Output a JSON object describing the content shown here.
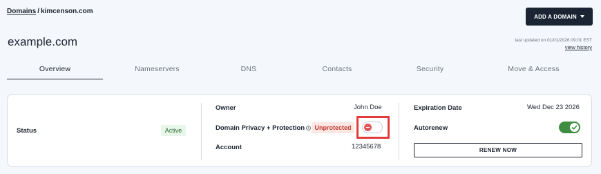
{
  "breadcrumb": {
    "root": "Domains",
    "separator": "/",
    "current": "kimcenson.com"
  },
  "header": {
    "add_domain_label": "ADD A DOMAIN",
    "title": "example.com"
  },
  "last_updated": {
    "text": "last updated on 01/01/2026 09:01 EST",
    "view_history": "view history"
  },
  "tabs": [
    {
      "label": "Overview",
      "active": true
    },
    {
      "label": "Nameservers",
      "active": false
    },
    {
      "label": "DNS",
      "active": false
    },
    {
      "label": "Contacts",
      "active": false
    },
    {
      "label": "Security",
      "active": false
    },
    {
      "label": "Move & Access",
      "active": false
    }
  ],
  "status": {
    "label": "Status",
    "value": "Active"
  },
  "owner": {
    "label": "Owner",
    "value": "John Doe"
  },
  "privacy": {
    "label": "Domain Privacy + Protection",
    "info": "i",
    "state": "Unprotected",
    "enabled": false
  },
  "account": {
    "label": "Account",
    "value": "12345678"
  },
  "expiration": {
    "label": "Expiration Date",
    "value": "Wed Dec 23 2026"
  },
  "autorenew": {
    "label": "Autorenew",
    "enabled": true
  },
  "renew_label": "RENEW NOW",
  "colors": {
    "primary_dark": "#1a2433",
    "active_green": "#3e8e41",
    "active_badge_bg": "#e8f5e9",
    "unprotected_red": "#c0392b",
    "unprotected_bg": "#fde7e5",
    "highlight_red": "#e23b3b",
    "toggle_off_knob": "#e25757"
  },
  "icons": {
    "add_domain": "chevron-down-icon",
    "privacy_info": "info-icon",
    "privacy_toggle": "minus-icon",
    "autorenew_toggle": "check-icon"
  }
}
